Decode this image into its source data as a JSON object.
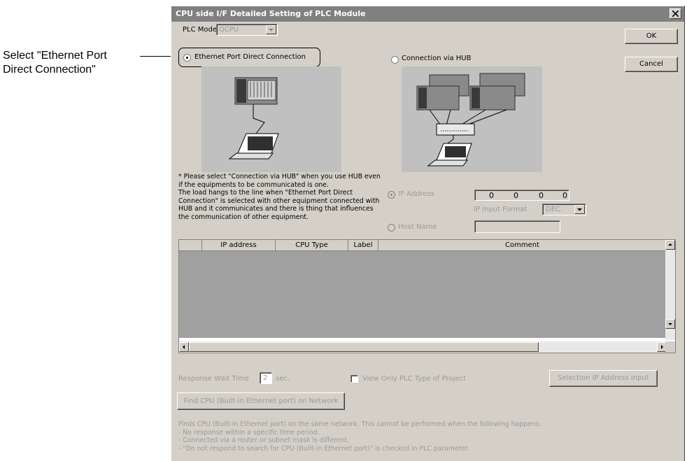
{
  "callout": {
    "line1": "Select \"Ethernet Port",
    "line2": "Direct Connection\""
  },
  "dialog": {
    "title": "CPU side I/F Detailed Setting of PLC Module",
    "plc_mode_label": "PLC Mode",
    "plc_mode_value": "QCPU",
    "ok_label": "OK",
    "cancel_label": "Cancel",
    "radio_direct": "Ethernet Port Direct Connection",
    "radio_hub": "Connection via HUB",
    "note": [
      "* Please select \"Connection via HUB\" when you use HUB even",
      "if the equipments to be communicated is one.",
      "The load hangs to the line when \"Ethernet Port Direct",
      "Connection\" is selected with other equipment connected with",
      "HUB and it communicates and there is thing that influences",
      "the communication of other equipment."
    ],
    "ip_address_label": "IP Address",
    "ip_values": [
      "0",
      "0",
      "0",
      "0"
    ],
    "ip_input_format_label": "IP Input Format",
    "ip_input_format_value": "DEC.",
    "host_name_label": "Host Name",
    "host_name_value": "",
    "table": {
      "columns": [
        "",
        "IP address",
        "CPU Type",
        "Label",
        "Comment"
      ],
      "rows": []
    },
    "response_wait_label": "Response Wait Time",
    "response_wait_value": "2",
    "response_wait_unit": "sec.",
    "view_only_label": "View Only PLC Type of Project",
    "selection_ip_button": "Selection IP Address Input",
    "find_cpu_button": "Find CPU (Built-in Ethernet port) on Network",
    "help_lines": [
      "Finds CPU (Built-in Ethernet port) on the same network. This cannot be performed when the following happens:",
      "- No response within a specific time period.",
      "- Connected via a router or subnet mask is different.",
      "- \"Do not respond to search for CPU (Built-in Ethernet port)\" is checked in PLC parameter."
    ]
  },
  "colors": {
    "dialog_bg": "#d4d0c8",
    "titlebar": "#808080",
    "grid_body": "#a0a0a0",
    "disabled_text": "#9a9a9a"
  }
}
